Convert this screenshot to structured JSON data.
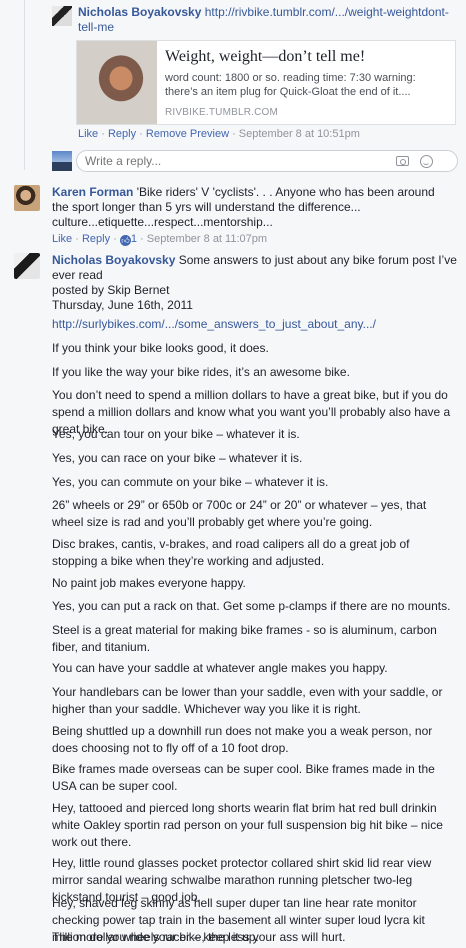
{
  "reply1": {
    "author": "Nicholas Boyakovsky",
    "link_text": "http://rivbike.tumblr.com/.../weight-weightdont-tell-me",
    "preview": {
      "title": "Weight, weight—don’t tell me!",
      "description": "word count: 1800 or so. reading time: 7:30 warning: there’s an item plug for Quick-Gloat the end of it....",
      "domain": "RIVBIKE.TUMBLR.COM"
    },
    "actions": {
      "like": "Like",
      "sep": " · ",
      "reply": "Reply",
      "remove_preview": "Remove Preview",
      "time": "September 8 at 10:51pm"
    }
  },
  "reply_input": {
    "placeholder": "Write a reply..."
  },
  "comment2": {
    "author": "Karen Forman",
    "text": "'Bike riders' V 'cyclists'. . . Anyone who has been around the sport longer than 5 yrs will understand the difference... culture...etiquette...respect...mentorship...",
    "actions": {
      "like": "Like",
      "reply": "Reply",
      "like_count": "1",
      "time": "September 8 at 11:07pm",
      "sep": " · "
    }
  },
  "comment3": {
    "author": "Nicholas Boyakovsky",
    "intro": "Some answers to just about any bike forum post I’ve ever read",
    "posted_by": "posted by Skip Bernet",
    "date": "Thursday, June 16th, 2011",
    "link_text": "http://surlybikes.com/.../some_answers_to_just_about_any.../",
    "paragraphs": [
      "If you think your bike looks good, it does.",
      "If you like the way your bike rides, it’s an awesome bike.",
      "You don’t need to spend a million dollars to have a great bike, but if you do spend a million dollars and know what you want you’ll probably also have a great bike.",
      "Yes, you can tour on your bike – whatever it is.",
      "Yes, you can race on your bike – whatever it is.",
      "Yes, you can commute on your bike – whatever it is.",
      "26” wheels or 29” or 650b or 700c or 24” or 20” or whatever – yes, that wheel size is rad and you’ll probably get where you’re going.",
      "Disc brakes, cantis, v-brakes, and road calipers all do a great job of stopping a bike when they’re working and adjusted.",
      "No paint job makes everyone happy.",
      "Yes, you can put a rack on that. Get some p-clamps if there are no mounts.",
      "Steel is a great material for making bike frames - so is aluminum, carbon fiber, and titanium.",
      "You can have your saddle at whatever angle makes you happy.",
      "Your handlebars can be lower than your saddle, even with your saddle, or higher than your saddle. Whichever way you like it is right.",
      "Being shuttled up a downhill run does not make you a weak person, nor does choosing not to fly off of a 10 foot drop.",
      "Bike frames made overseas can be super cool. Bike frames made in the USA can be super cool.",
      "Hey, tattooed and pierced long shorts wearin flat brim hat red bull drinkin white Oakley sportin rad person on your full suspension big hit bike – nice work out there.",
      "Hey, little round glasses pocket protector collared shirt skid lid rear view mirror sandal wearing schwalbe marathon running pletscher two-leg kickstand tourist – good job.",
      "Hey, shaved leg skinny as hell super duper tan line hear rate monitor checking power tap train in the basement all winter super loud lycra kit million dollar wheels racer – keep it up.",
      "The more you ride your bike, the less your ass will hurt."
    ]
  },
  "colors": {
    "link": "#365899",
    "meta": "#90949c",
    "background": "#f6f7f9"
  }
}
